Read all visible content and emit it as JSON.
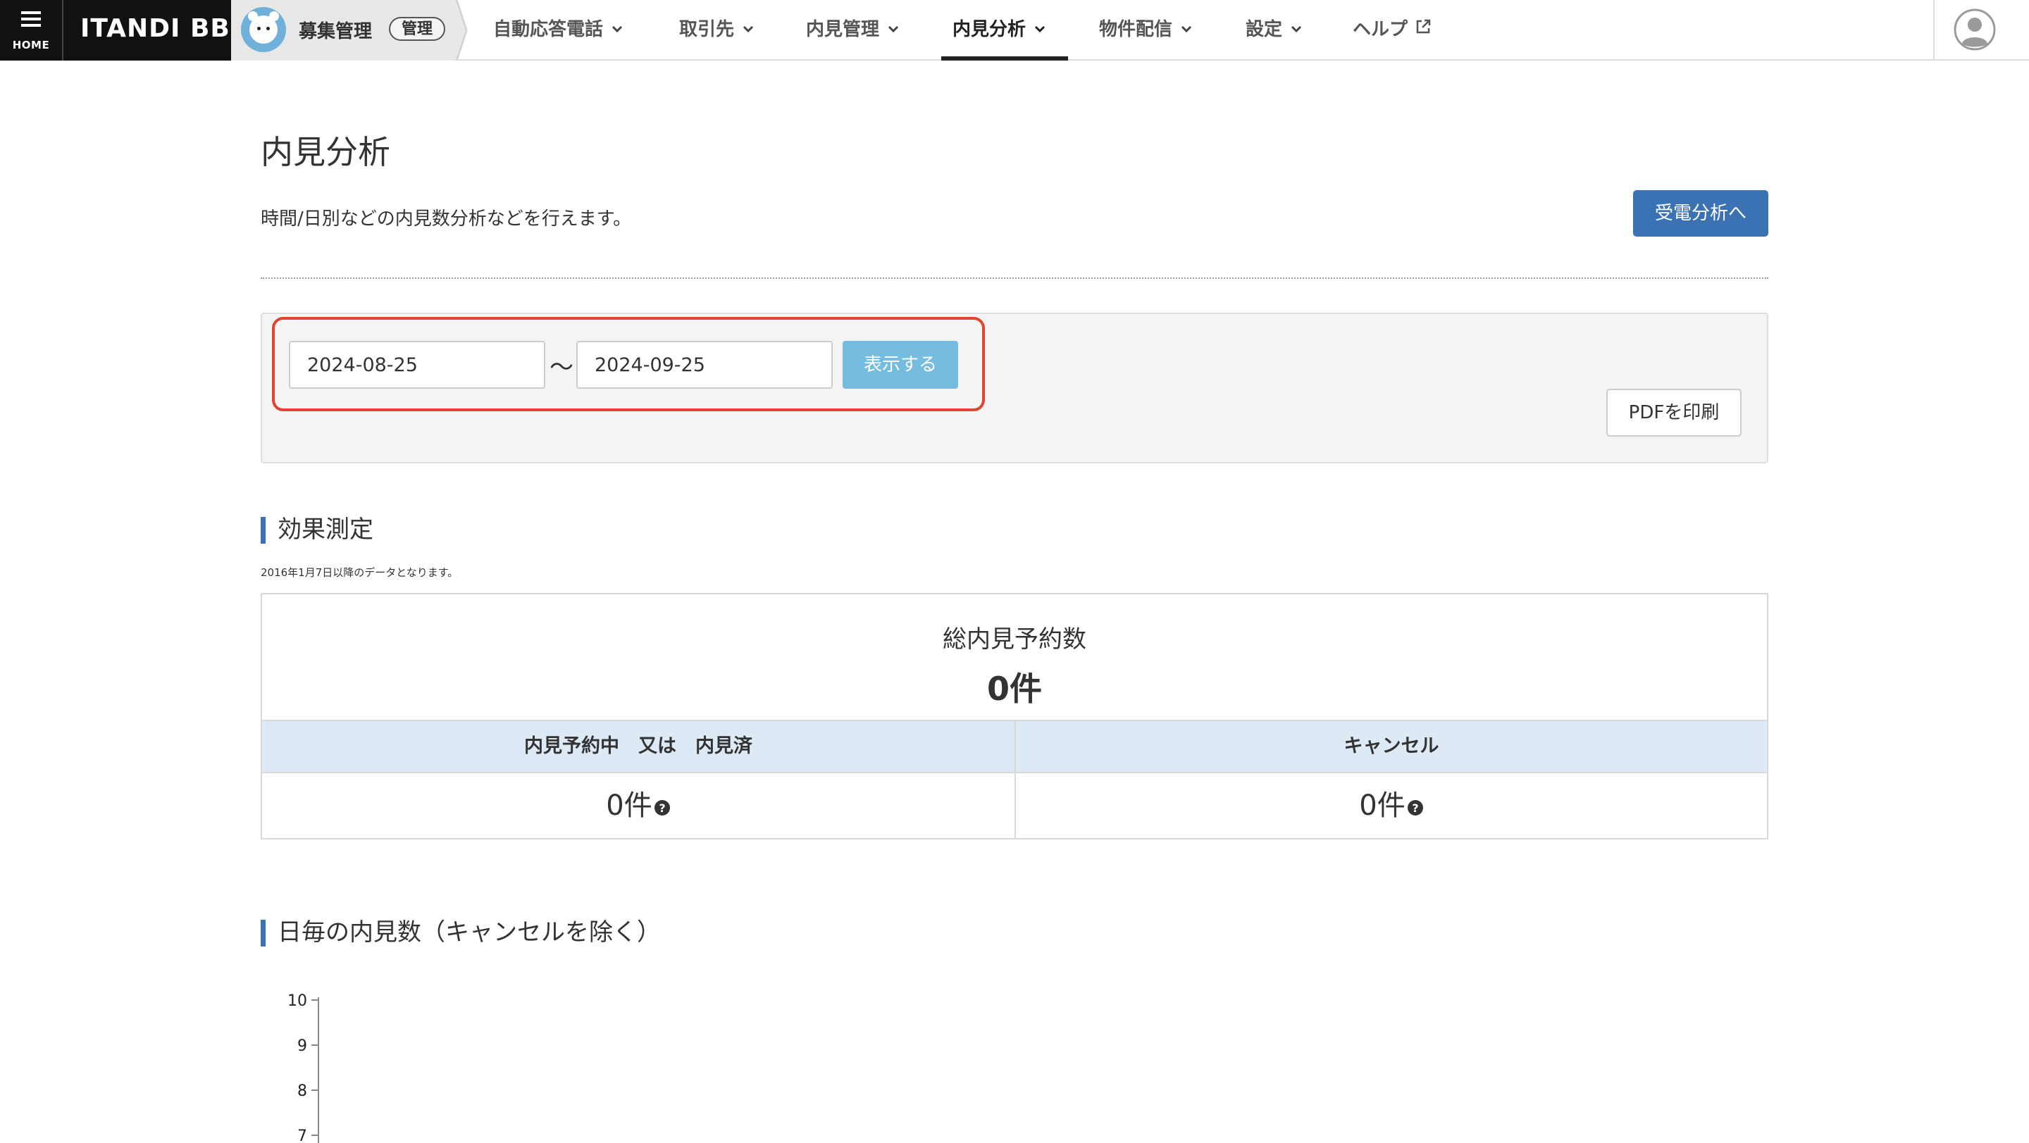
{
  "nav": {
    "home_label": "HOME",
    "brand": "ITANDI BB",
    "app_name": "募集管理",
    "app_badge": "管理",
    "items": [
      {
        "label": "自動応答電話",
        "has_dropdown": true
      },
      {
        "label": "取引先",
        "has_dropdown": true
      },
      {
        "label": "内見管理",
        "has_dropdown": true
      },
      {
        "label": "内見分析",
        "has_dropdown": true,
        "active": true
      },
      {
        "label": "物件配信",
        "has_dropdown": true
      },
      {
        "label": "設定",
        "has_dropdown": true
      },
      {
        "label": "ヘルプ",
        "external": true
      }
    ]
  },
  "page": {
    "title": "内見分析",
    "description": "時間/日別などの内見数分析などを行えます。",
    "call_analysis_button": "受電分析へ"
  },
  "filter": {
    "start_date": "2024-08-25",
    "separator": "〜",
    "end_date": "2024-09-25",
    "show_button": "表示する",
    "pdf_button": "PDFを印刷"
  },
  "effect": {
    "heading": "効果測定",
    "note": "2016年1月7日以降のデータとなります。",
    "total_label": "総内見予約数",
    "total_value": "0件",
    "col1_label": "内見予約中　又は　内見済",
    "col1_value": "0件",
    "col2_label": "キャンセル",
    "col2_value": "0件"
  },
  "daily": {
    "heading": "日毎の内見数（キャンセルを除く）"
  },
  "chart_data": {
    "type": "bar",
    "categories": [],
    "values": [],
    "y_ticks": [
      "10",
      "9",
      "8",
      "7"
    ],
    "ylim": [
      0,
      10
    ]
  },
  "colors": {
    "primary": "#3a72b4",
    "show_button": "#74bde0",
    "highlight": "#e0452f",
    "table_header": "#dde9f4"
  }
}
